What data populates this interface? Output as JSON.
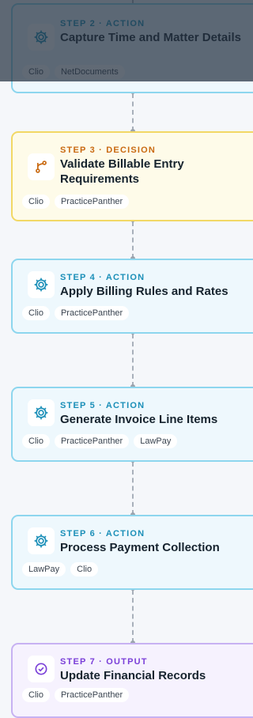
{
  "steps": [
    {
      "kind": "action",
      "icon": "gear-icon",
      "label": "STEP 2 · ACTION",
      "title": "Capture Time and Matter Details",
      "tags": [
        "Clio",
        "NetDocuments"
      ]
    },
    {
      "kind": "decision",
      "icon": "branch-icon",
      "label": "STEP 3 · DECISION",
      "title": "Validate Billable Entry Requirements",
      "tags": [
        "Clio",
        "PracticePanther"
      ]
    },
    {
      "kind": "action",
      "icon": "gear-icon",
      "label": "STEP 4 · ACTION",
      "title": "Apply Billing Rules and Rates",
      "tags": [
        "Clio",
        "PracticePanther"
      ]
    },
    {
      "kind": "action",
      "icon": "gear-icon",
      "label": "STEP 5 · ACTION",
      "title": "Generate Invoice Line Items",
      "tags": [
        "Clio",
        "PracticePanther",
        "LawPay"
      ]
    },
    {
      "kind": "action",
      "icon": "gear-icon",
      "label": "STEP 6 · ACTION",
      "title": "Process Payment Collection",
      "tags": [
        "LawPay",
        "Clio"
      ]
    },
    {
      "kind": "output",
      "icon": "check-circle-icon",
      "label": "STEP 7 · OUTPUT",
      "title": "Update Financial Records",
      "tags": [
        "Clio",
        "PracticePanther"
      ]
    }
  ],
  "colors": {
    "action": "#1b8fb8",
    "decision": "#c96a12",
    "output": "#7a3fd8"
  }
}
